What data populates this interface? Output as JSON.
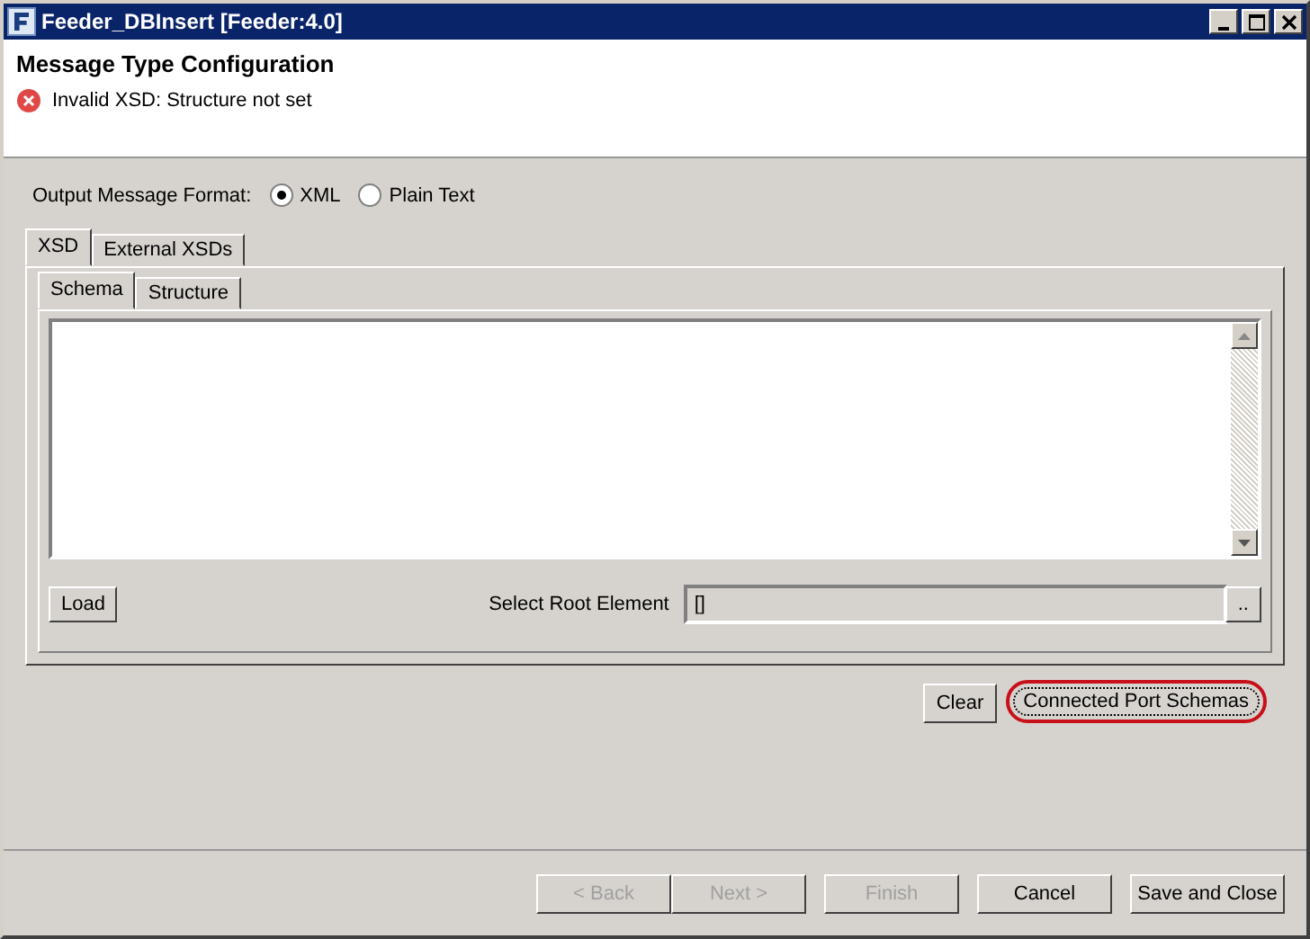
{
  "window": {
    "title": "Feeder_DBInsert [Feeder:4.0]"
  },
  "header": {
    "title": "Message Type Configuration",
    "error": "Invalid XSD: Structure not set"
  },
  "output_format": {
    "label": "Output Message Format:",
    "options": [
      {
        "label": "XML",
        "selected": true
      },
      {
        "label": "Plain Text",
        "selected": false
      }
    ]
  },
  "tabs": [
    {
      "label": "XSD",
      "selected": true
    },
    {
      "label": "External XSDs",
      "selected": false
    }
  ],
  "subtabs": [
    {
      "label": "Schema",
      "selected": true
    },
    {
      "label": "Structure",
      "selected": false
    }
  ],
  "load_button": "Load",
  "root_element": {
    "label": "Select Root Element",
    "value": "[]",
    "browse": ".."
  },
  "actions": [
    {
      "label": "Clear",
      "highlighted": false
    },
    {
      "label": "Connected Port Schemas",
      "highlighted": true
    }
  ],
  "buttons": [
    {
      "label": "< Back",
      "disabled": true
    },
    {
      "label": "Next >",
      "disabled": true
    },
    {
      "label": "Finish",
      "disabled": true
    },
    {
      "label": "Cancel",
      "disabled": false
    },
    {
      "label": "Save and Close",
      "disabled": false
    }
  ]
}
